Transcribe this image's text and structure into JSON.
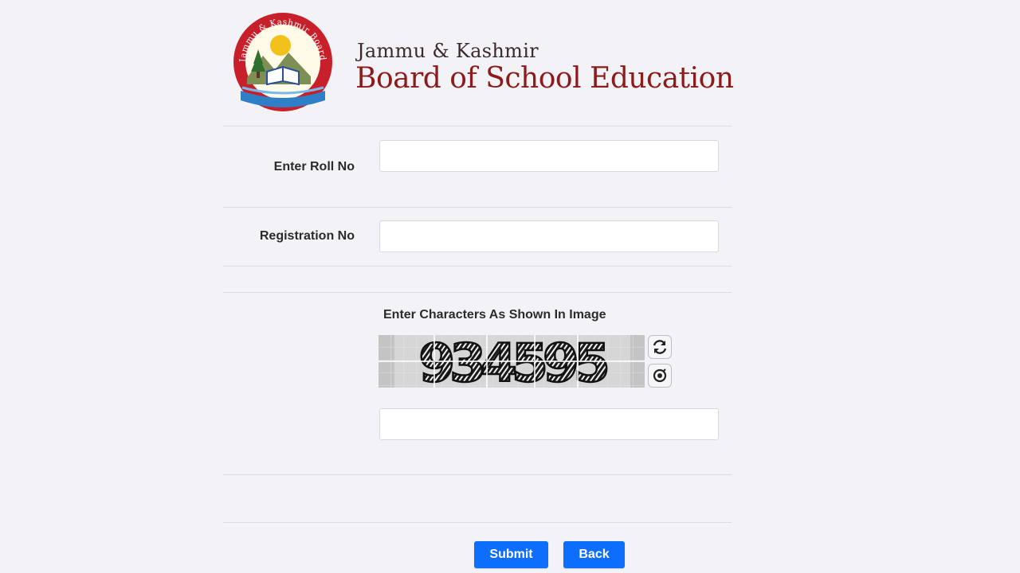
{
  "header": {
    "logo_ring_text": "Jammu & Kashmir Board Of School Education",
    "subtitle": "Jammu & Kashmir",
    "title": "Board of School Education"
  },
  "form": {
    "roll_no": {
      "label": "Enter Roll No",
      "value": "",
      "placeholder": ""
    },
    "registration_no": {
      "label": "Registration No",
      "value": "",
      "placeholder": ""
    },
    "captcha": {
      "label": "Enter Characters As Shown In Image",
      "code": "934595",
      "value": "",
      "refresh_icon": "refresh-icon",
      "audio_icon": "audio-icon"
    }
  },
  "actions": {
    "submit_label": "Submit",
    "back_label": "Back"
  },
  "colors": {
    "brand": "#8c1c1c",
    "button": "#0d6efd",
    "background": "#f3f3f7"
  }
}
